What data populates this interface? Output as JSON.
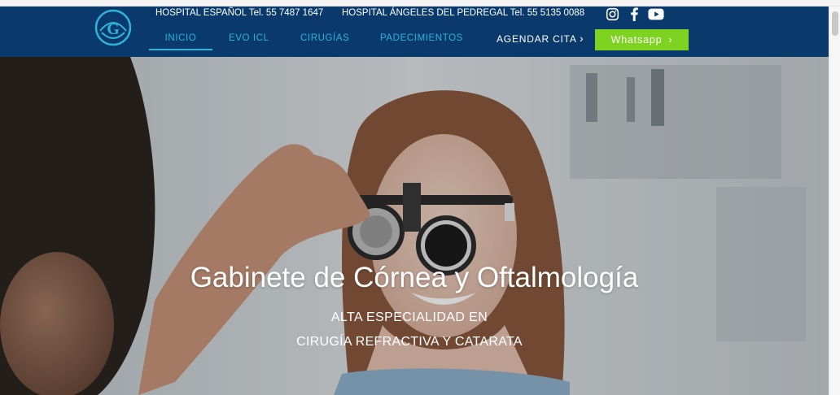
{
  "header": {
    "contacts": [
      {
        "text": "HOSPITAL ESPAÑOL Tel. 55 7487 1647"
      },
      {
        "text": "HOSPITAL ÁNGELES DEL PEDREGAL  Tel. 55 5135 0088"
      }
    ],
    "social": [
      "instagram-icon",
      "facebook-icon",
      "youtube-icon"
    ],
    "nav": {
      "inicio": "INICIO",
      "evo": "EVO ICL",
      "cirugias": "CIRUGÍAS",
      "padecimientos": "PADECIMIENTOS"
    },
    "agendar": "AGENDAR CITA",
    "whatsapp": "Whatsapp",
    "chevron": "›"
  },
  "hero": {
    "title": "Gabinete de Córnea y Oftalmología",
    "subtitle_1": "ALTA ESPECIALIDAD EN",
    "subtitle_2": "CIRUGÍA REFRACTIVA Y CATARATA"
  },
  "colors": {
    "header_bg": "#0a3a6b",
    "nav_accent": "#2fb3d8",
    "whatsapp_bg": "#7ed321"
  }
}
